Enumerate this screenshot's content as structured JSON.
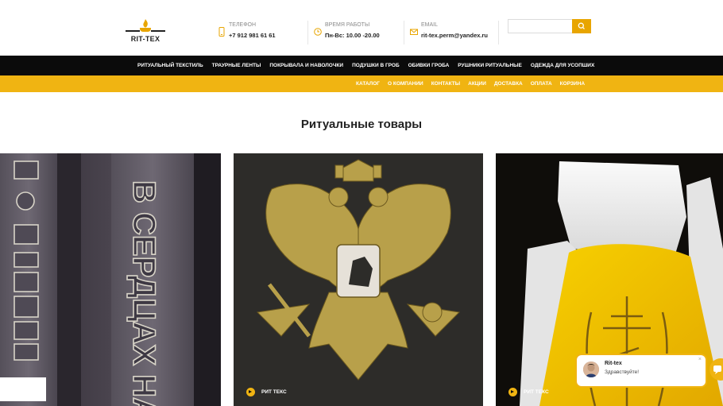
{
  "header": {
    "logo_text": "RIT-TEX",
    "phone": {
      "label": "ТЕЛЕФОН",
      "value": "+7 912 981 61 61"
    },
    "hours": {
      "label": "ВРЕМЯ РАБОТЫ",
      "value": "Пн-Вс: 10.00 -20.00"
    },
    "email": {
      "label": "EMAIL",
      "value": "rit-tex.perm@yandex.ru"
    },
    "search": {
      "placeholder": "",
      "icon": "search-icon"
    },
    "accent": "#e8a500"
  },
  "nav_main": {
    "items": [
      {
        "label": "РИТУАЛЬНЫЙ ТЕКСТИЛЬ"
      },
      {
        "label": "ТРАУРНЫЕ ЛЕНТЫ"
      },
      {
        "label": "ПОКРЫВАЛА И НАВОЛОЧКИ"
      },
      {
        "label": "ПОДУШКИ В ГРОБ"
      },
      {
        "label": "ОБИВКИ ГРОБА"
      },
      {
        "label": "РУШНИКИ РИТУАЛЬНЫЕ"
      },
      {
        "label": "ОДЕЖДА ДЛЯ УСОПШИХ"
      }
    ]
  },
  "nav_secondary": {
    "items": [
      {
        "label": "КАТАЛОГ"
      },
      {
        "label": "О КОМПАНИИ"
      },
      {
        "label": "КОНТАКТЫ"
      },
      {
        "label": "АКЦИИ"
      },
      {
        "label": "ДОСТАВКА"
      },
      {
        "label": "ОПЛАТА"
      },
      {
        "label": "КОРЗИНА"
      }
    ]
  },
  "main": {
    "title": "Ритуальные товары",
    "cards": [
      {
        "caption": "",
        "image_text": "В СЕРДЦАХ НА"
      },
      {
        "caption": "РИТ ТЕКС"
      },
      {
        "caption": "РИТ ТЕКС"
      }
    ]
  },
  "chat": {
    "name": "Rit-tex",
    "message": "Здравствуйте!",
    "close": "×"
  }
}
